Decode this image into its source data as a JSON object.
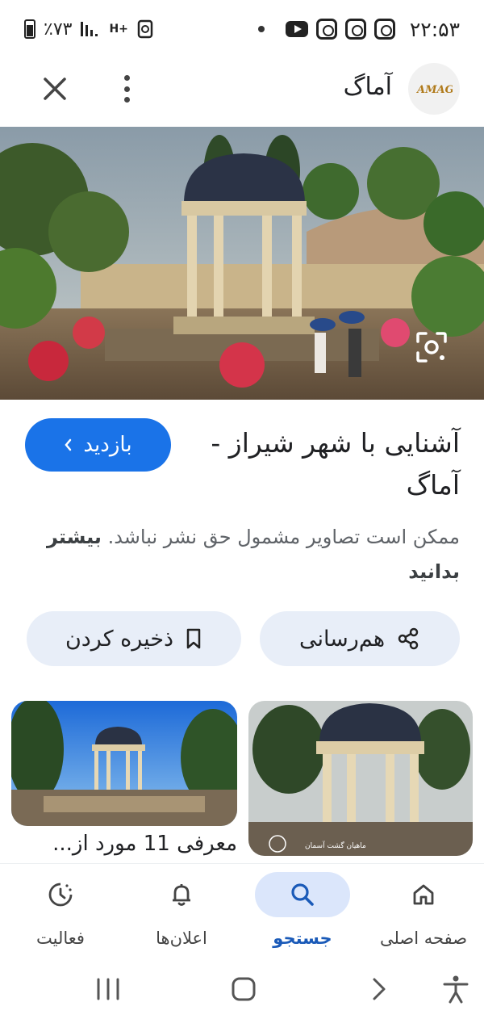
{
  "status_bar": {
    "time": "۲۲:۵۳",
    "battery": "٪۷۳",
    "network": "H+",
    "icons": [
      "instagram-icon",
      "instagram-icon",
      "instagram-icon",
      "youtube-icon"
    ]
  },
  "header": {
    "site_name": "آماگ",
    "logo_text": "AMAG"
  },
  "result": {
    "title": "آشنایی با شهر شیراز - آماگ",
    "visit_label": "بازدید",
    "notice_text": "ممکن است تصاویر مشمول حق نشر نباشد.",
    "learn_more": "بیشتر بدانید"
  },
  "actions": {
    "share_label": "هم‌رسانی",
    "save_label": "ذخیره کردن"
  },
  "related": {
    "caption": "معرفی 11 مورد از...",
    "watermark": "ماهیان گشت آسمان"
  },
  "bottom_nav": {
    "items": [
      {
        "label": "صفحه اصلی",
        "icon": "home-icon"
      },
      {
        "label": "جستجو",
        "icon": "search-icon",
        "active": true
      },
      {
        "label": "اعلان‌ها",
        "icon": "bell-icon"
      },
      {
        "label": "فعالیت",
        "icon": "activity-icon"
      }
    ]
  },
  "colors": {
    "accent": "#1a73e8",
    "chip_bg": "#e8eef8",
    "nav_active_bg": "#dbe6fb"
  }
}
